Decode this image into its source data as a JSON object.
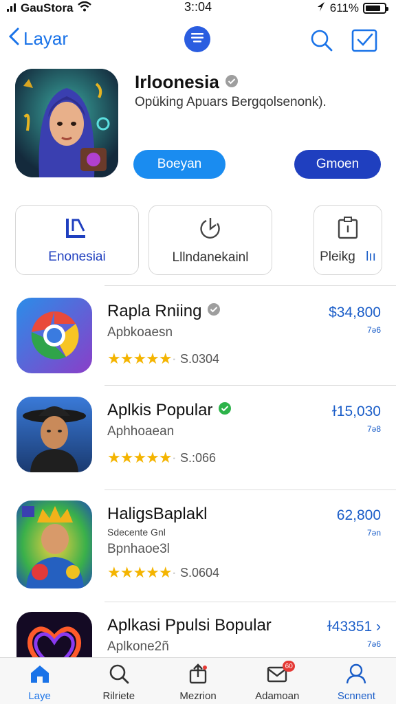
{
  "status_bar": {
    "carrier": "GauStora",
    "time": "3::04",
    "battery": "611%"
  },
  "nav": {
    "back_label": "Layar"
  },
  "featured": {
    "title": "Irloonesia",
    "subtitle": "Opüking Apuars Bergqolsenonk).",
    "primary_button": "Boeyan",
    "secondary_button": "Gmoen"
  },
  "categories": [
    {
      "label": "Enonesiai"
    },
    {
      "label": "Lllndanekainl"
    },
    {
      "label": "Pleikg",
      "extra": "lıı"
    }
  ],
  "apps": [
    {
      "name": "Rapla Rniing",
      "developer": "Apbkoaesn",
      "rating_text": "S.0304",
      "price": "$34,800",
      "price_sub": "7ə6",
      "verified_color": "#9e9e9e"
    },
    {
      "name": "Aplkis Popular",
      "developer": "Aphhoaean",
      "rating_text": "S.:066",
      "price": "ɫ15,030",
      "price_sub": "7ə8",
      "verified_color": "#2db34a"
    },
    {
      "name": "HaligsBaplakl",
      "subtitle": "Sdecente Gnl",
      "developer": "Bpnhaoe3l",
      "rating_text": "S.0604",
      "price": "62,800",
      "price_sub": "7ən"
    },
    {
      "name": "Aplkasi Ppulsi Bopular",
      "developer": "Aplkone2ñ",
      "price": "ɫ43351 ›",
      "price_sub": "7ə6"
    }
  ],
  "tabs": [
    {
      "label": "Laye",
      "active": true
    },
    {
      "label": "Rilriete"
    },
    {
      "label": "Mezrion"
    },
    {
      "label": "Adamoan",
      "badge": "60"
    },
    {
      "label": "Scnnent"
    }
  ],
  "colors": {
    "accent": "#1a73e8",
    "star": "#f4b400",
    "price": "#1a5dc8"
  }
}
